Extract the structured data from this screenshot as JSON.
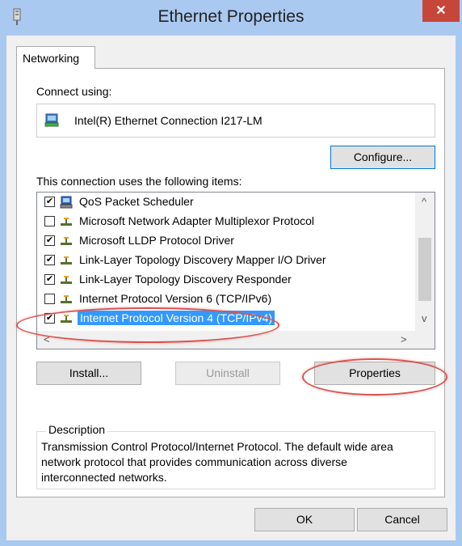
{
  "window": {
    "title": "Ethernet Properties",
    "close_glyph": "✕"
  },
  "tabs": [
    {
      "label": "Networking"
    }
  ],
  "connect_using": {
    "label": "Connect using:",
    "adapter_name": "Intel(R) Ethernet Connection I217-LM",
    "configure_button": "Configure..."
  },
  "items_section": {
    "label": "This connection uses the following items:",
    "items": [
      {
        "checked": true,
        "checkmark": "✔",
        "label": "QoS Packet Scheduler",
        "icon": "network-computer-icon"
      },
      {
        "checked": false,
        "checkmark": "",
        "label": "Microsoft Network Adapter Multiplexor Protocol",
        "icon": "network-protocol-icon"
      },
      {
        "checked": true,
        "checkmark": "✔",
        "label": "Microsoft LLDP Protocol Driver",
        "icon": "network-protocol-icon"
      },
      {
        "checked": true,
        "checkmark": "✔",
        "label": "Link-Layer Topology Discovery Mapper I/O Driver",
        "icon": "network-protocol-icon"
      },
      {
        "checked": true,
        "checkmark": "✔",
        "label": "Link-Layer Topology Discovery Responder",
        "icon": "network-protocol-icon"
      },
      {
        "checked": false,
        "checkmark": "",
        "label": "Internet Protocol Version 6 (TCP/IPv6)",
        "icon": "network-protocol-icon"
      },
      {
        "checked": true,
        "checkmark": "✔",
        "label": "Internet Protocol Version 4 (TCP/IPv4)",
        "icon": "network-protocol-icon",
        "selected": true
      }
    ],
    "scroll_up": "^",
    "scroll_down": "v",
    "scroll_left": "<",
    "scroll_right": ">"
  },
  "buttons": {
    "install": "Install...",
    "uninstall": "Uninstall",
    "properties": "Properties",
    "ok": "OK",
    "cancel": "Cancel"
  },
  "description": {
    "title": "Description",
    "text": "Transmission Control Protocol/Internet Protocol. The default wide area network protocol that provides communication across diverse interconnected networks."
  },
  "colors": {
    "title_bar": "#aac9f0",
    "close_button": "#c7463a",
    "selection": "#3399ff",
    "annotation_red": "#d9534f"
  }
}
